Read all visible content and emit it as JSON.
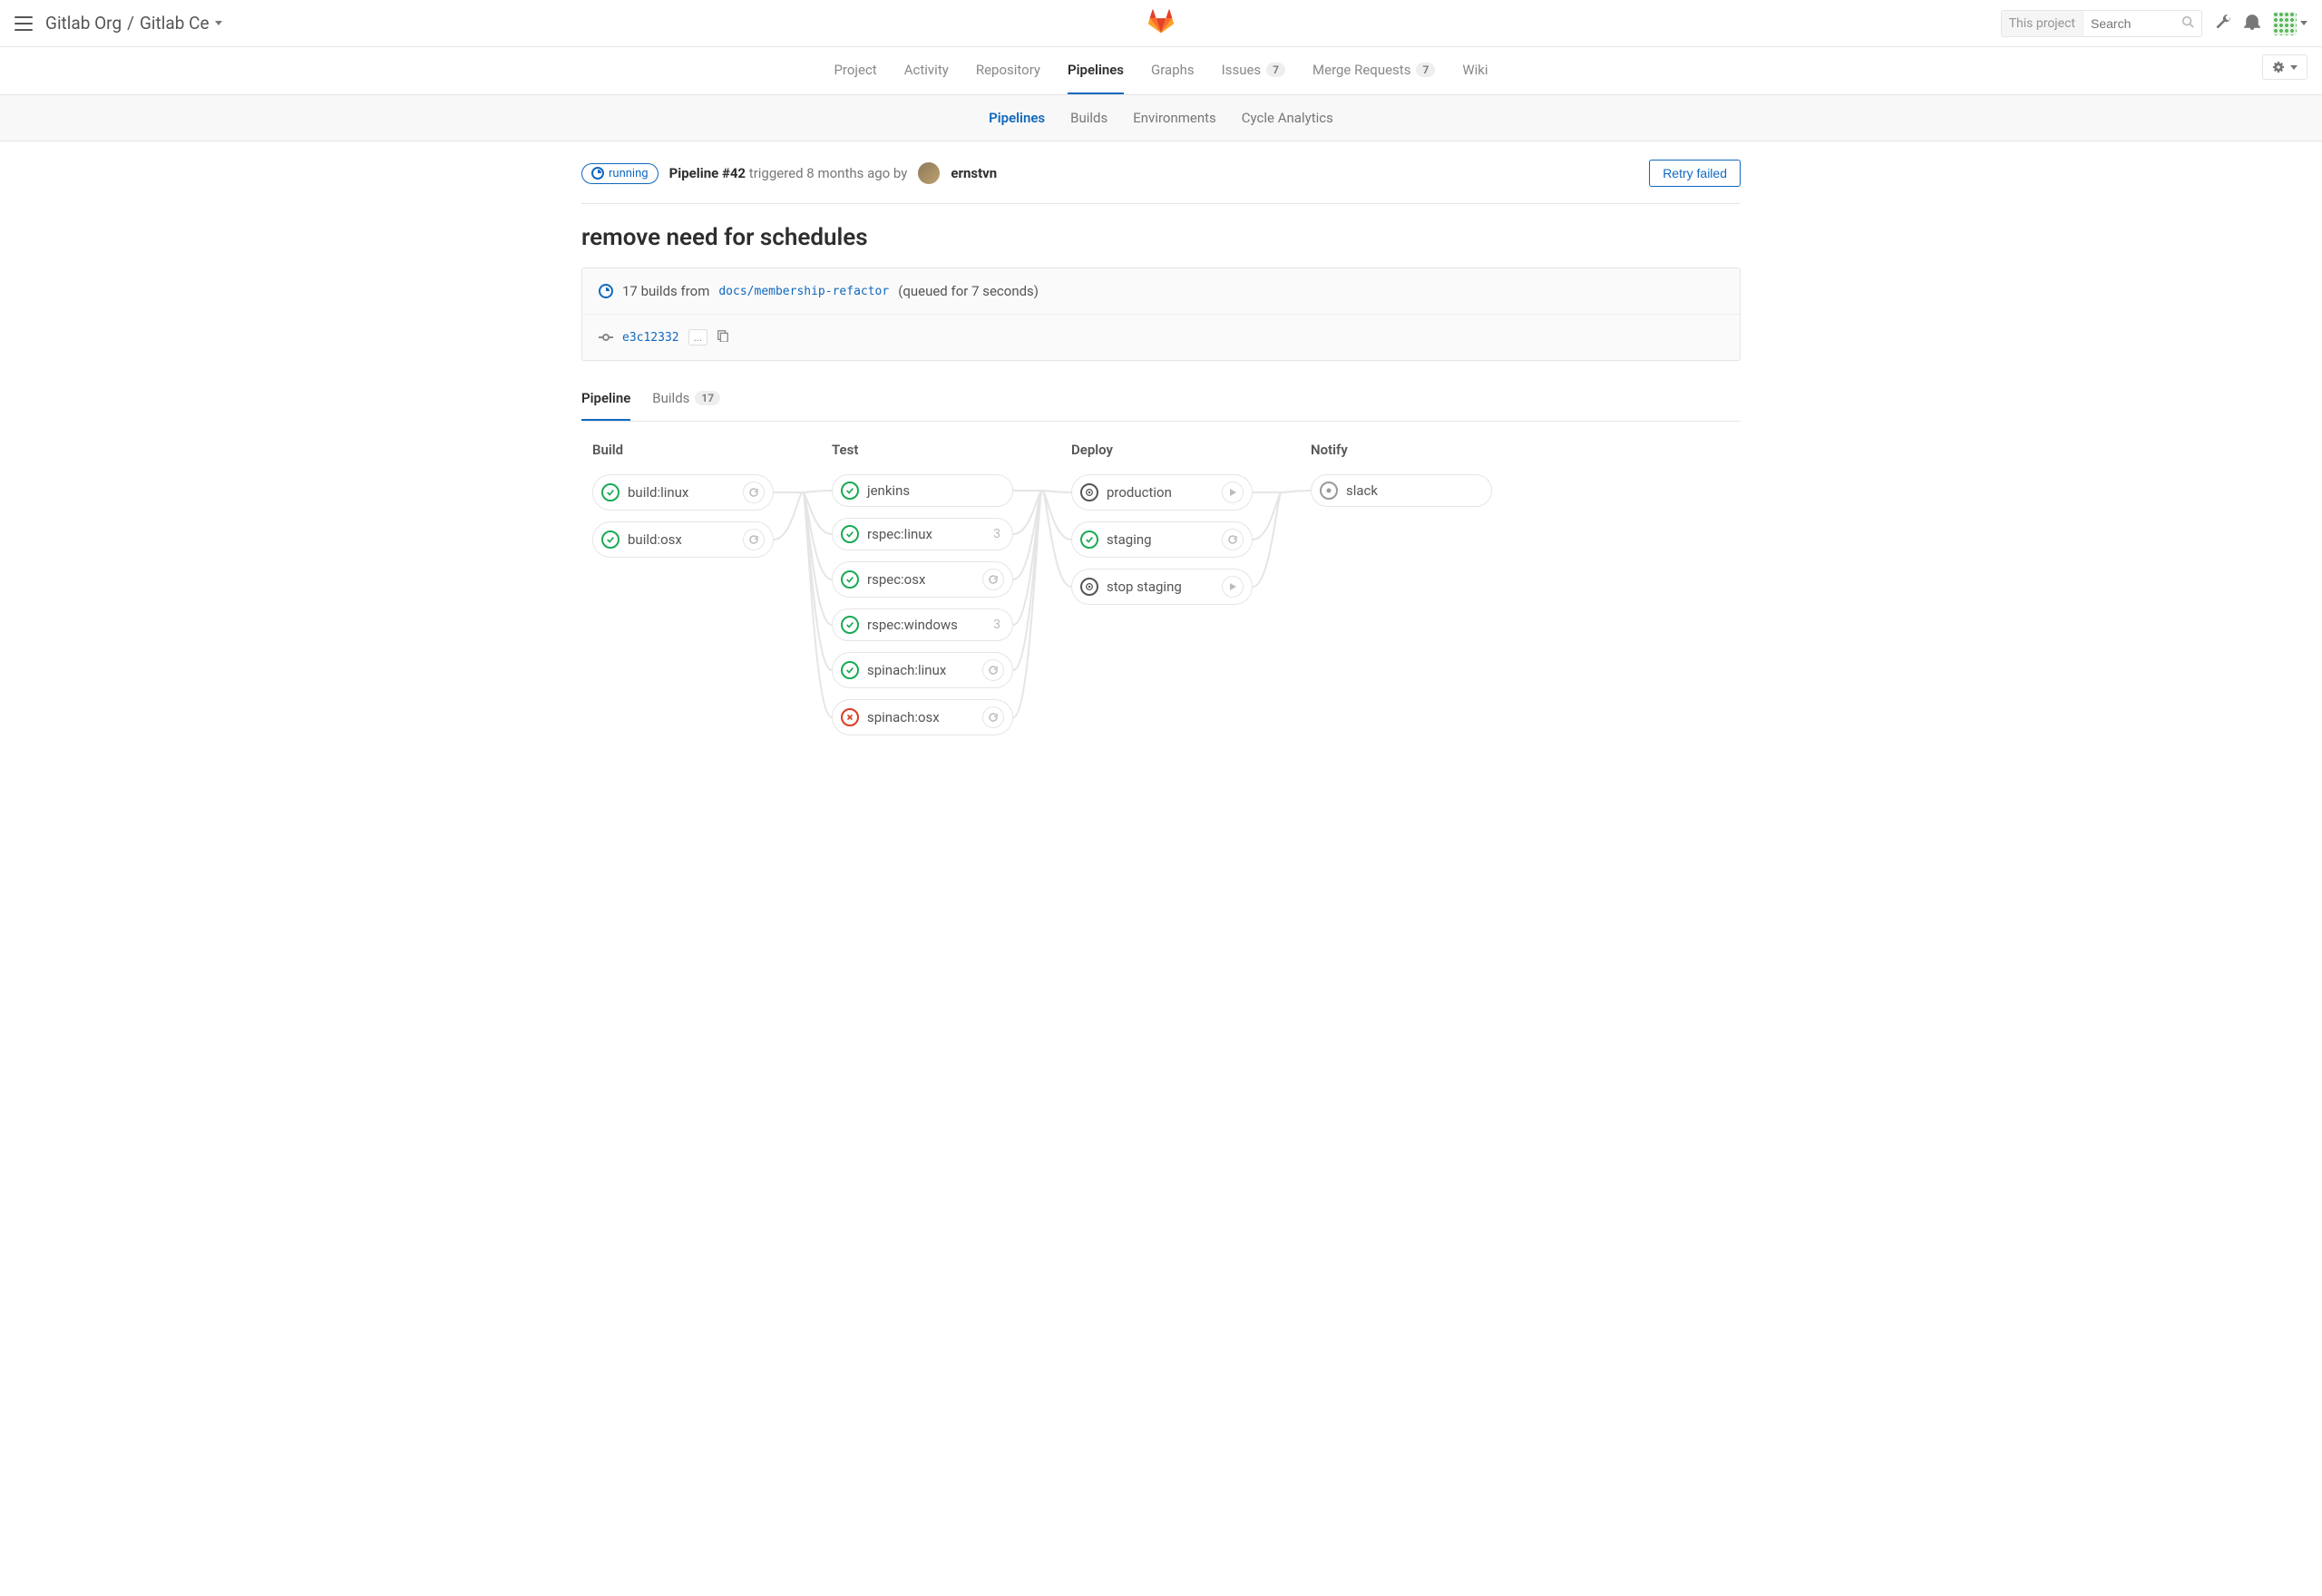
{
  "breadcrumb": {
    "group": "Gitlab Org",
    "project": "Gitlab Ce"
  },
  "search": {
    "scope": "This project",
    "placeholder": "Search"
  },
  "nav": {
    "project": "Project",
    "activity": "Activity",
    "repository": "Repository",
    "pipelines": "Pipelines",
    "graphs": "Graphs",
    "issues": "Issues",
    "issues_count": "7",
    "mrs": "Merge Requests",
    "mrs_count": "7",
    "wiki": "Wiki"
  },
  "subnav": {
    "pipelines": "Pipelines",
    "builds": "Builds",
    "environments": "Environments",
    "cycle": "Cycle Analytics"
  },
  "header": {
    "status": "running",
    "label": "Pipeline",
    "id": "#42",
    "triggered_text": "triggered 8 months ago by",
    "user": "ernstvn",
    "retry": "Retry failed"
  },
  "title": "remove need for schedules",
  "well": {
    "builds_count": "17 builds from",
    "branch": "docs/membership-refactor",
    "queued": "(queued for 7 seconds)",
    "commit": "e3c12332",
    "ellipsis": "..."
  },
  "mini_tabs": {
    "pipeline": "Pipeline",
    "builds": "Builds",
    "builds_count": "17"
  },
  "stages": [
    {
      "name": "Build",
      "jobs": [
        {
          "label": "build:linux",
          "status": "success",
          "action": "retry"
        },
        {
          "label": "build:osx",
          "status": "success",
          "action": "retry"
        }
      ]
    },
    {
      "name": "Test",
      "jobs": [
        {
          "label": "jenkins",
          "status": "success"
        },
        {
          "label": "rspec:linux",
          "status": "success",
          "count": "3"
        },
        {
          "label": "rspec:osx",
          "status": "success",
          "action": "retry"
        },
        {
          "label": "rspec:windows",
          "status": "success",
          "count": "3"
        },
        {
          "label": "spinach:linux",
          "status": "success",
          "action": "retry"
        },
        {
          "label": "spinach:osx",
          "status": "failed",
          "action": "retry"
        }
      ]
    },
    {
      "name": "Deploy",
      "jobs": [
        {
          "label": "production",
          "status": "manual",
          "action": "play"
        },
        {
          "label": "staging",
          "status": "success",
          "action": "retry"
        },
        {
          "label": "stop staging",
          "status": "manual",
          "action": "play"
        }
      ]
    },
    {
      "name": "Notify",
      "jobs": [
        {
          "label": "slack",
          "status": "skipped"
        }
      ]
    }
  ]
}
